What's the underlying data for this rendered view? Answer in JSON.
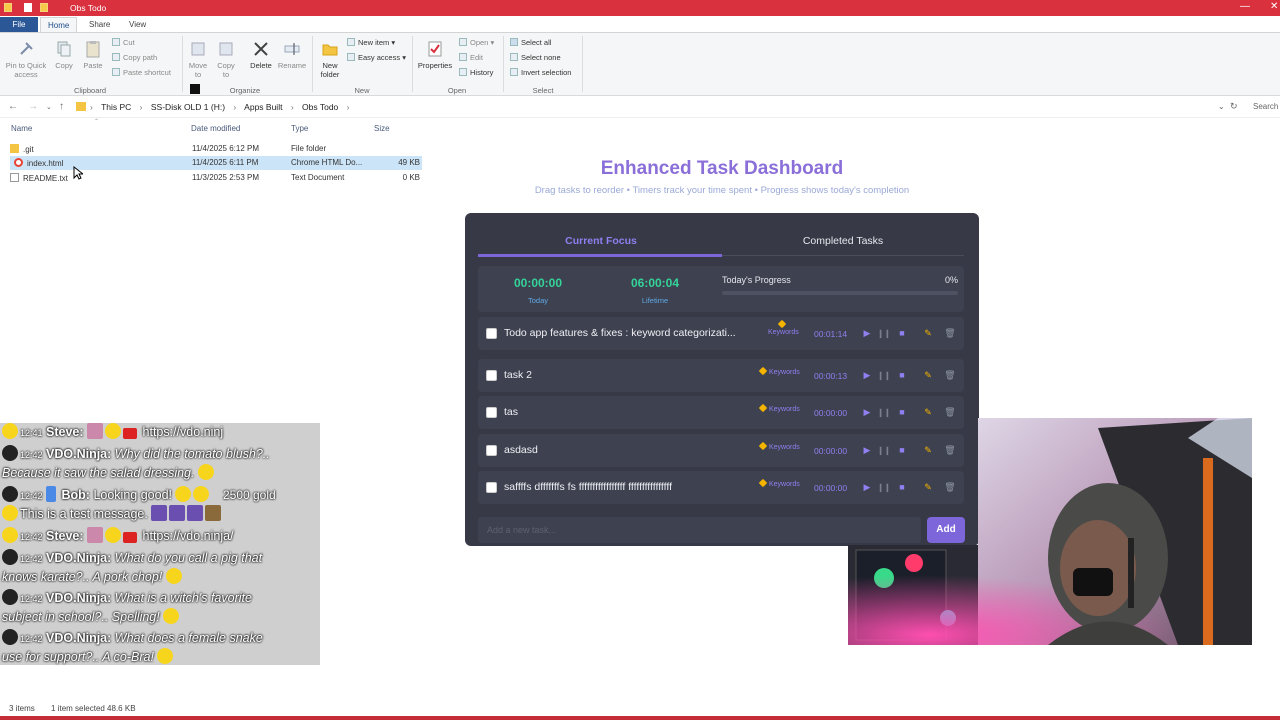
{
  "window": {
    "title": "Obs Todo"
  },
  "ribbon": {
    "tabs": [
      "File",
      "Home",
      "Share",
      "View"
    ],
    "clipboard": {
      "pin": "Pin to Quick access",
      "copy": "Copy",
      "paste": "Paste",
      "cut": "Cut",
      "copy_path": "Copy path",
      "paste_shortcut": "Paste shortcut",
      "group": "Clipboard"
    },
    "organize": {
      "move_to": "Move to",
      "copy_to": "Copy to",
      "delete": "Delete",
      "rename": "Rename",
      "group": "Organize"
    },
    "new": {
      "new_folder": "New folder",
      "new_item": "New item",
      "easy_access": "Easy access",
      "group": "New"
    },
    "open": {
      "properties": "Properties",
      "open": "Open",
      "edit": "Edit",
      "history": "History",
      "group": "Open"
    },
    "select": {
      "select_all": "Select all",
      "select_none": "Select none",
      "invert": "Invert selection",
      "group": "Select"
    }
  },
  "address": {
    "crumbs": [
      "This PC",
      "SS-Disk OLD 1 (H:)",
      "Apps Built",
      "Obs Todo"
    ],
    "search_placeholder": "Search"
  },
  "files": {
    "columns": [
      "Name",
      "Date modified",
      "Type",
      "Size"
    ],
    "rows": [
      {
        "name": ".git",
        "date": "11/4/2025 6:12 PM",
        "type": "File folder",
        "size": ""
      },
      {
        "name": "index.html",
        "date": "11/4/2025 6:11 PM",
        "type": "Chrome HTML Do...",
        "size": "49 KB"
      },
      {
        "name": "README.txt",
        "date": "11/3/2025 2:53 PM",
        "type": "Text Document",
        "size": "0 KB"
      }
    ],
    "status_items": "3 items",
    "status_selected": "1 item selected  48.6 KB"
  },
  "dashboard": {
    "title": "Enhanced Task Dashboard",
    "subtitle": "Drag tasks to reorder • Timers track your time spent • Progress shows today's completion",
    "tabs": {
      "focus": "Current Focus",
      "completed": "Completed Tasks"
    },
    "today_time": "00:00:00",
    "today_label": "Today",
    "lifetime_time": "06:00:04",
    "lifetime_label": "Lifetime",
    "progress_label": "Today's Progress",
    "progress_pct": "0%",
    "progress_value": 0,
    "tasks": [
      {
        "name": "Todo app features & fixes : keyword categorizati...",
        "tag": "Keywords",
        "time": "00:01:14"
      },
      {
        "name": "task 2",
        "tag": "Keywords",
        "time": "00:00:13"
      },
      {
        "name": "tas",
        "tag": "Keywords",
        "time": "00:00:00"
      },
      {
        "name": "asdasd",
        "tag": "Keywords",
        "time": "00:00:00"
      },
      {
        "name": "saffffs dfffffffs fs fffffffffffffffff ffffffffffffffff",
        "tag": "Keywords",
        "time": "00:00:00"
      }
    ],
    "new_task_placeholder": "Add a new task...",
    "add_label": "Add"
  },
  "chat": {
    "messages": [
      {
        "time": "12:41",
        "user": "Steve:",
        "text": "https://vdo.ninj"
      },
      {
        "time": "12:42",
        "user": "VDO.Ninja:",
        "text": "Why did the tomato blush?.."
      },
      {
        "text": "Because it saw the salad dressing."
      },
      {
        "time": "12:42",
        "user": "Bob:",
        "text": "Looking good!",
        "badge": "2500 gold"
      },
      {
        "text": "This is a test message."
      },
      {
        "time": "12:42",
        "user": "Steve:",
        "text": "https://vdo.ninja/"
      },
      {
        "time": "12:42",
        "user": "VDO.Ninja:",
        "text": "What do you call a pig that"
      },
      {
        "text": "knows karate?.. A pork chop!"
      },
      {
        "time": "12:42",
        "user": "VDO.Ninja:",
        "text": "What is a witch's favorite"
      },
      {
        "text": "subject in school?.. Spelling!"
      },
      {
        "time": "12:42",
        "user": "VDO.Ninja:",
        "text": "What does a female snake"
      },
      {
        "text": "use for support?.. A co-Bra!"
      }
    ]
  },
  "colors": {
    "titlebar": "#d9313d",
    "accent": "#7c66d9",
    "timer_green": "#34d399",
    "panel": "#373a46"
  }
}
